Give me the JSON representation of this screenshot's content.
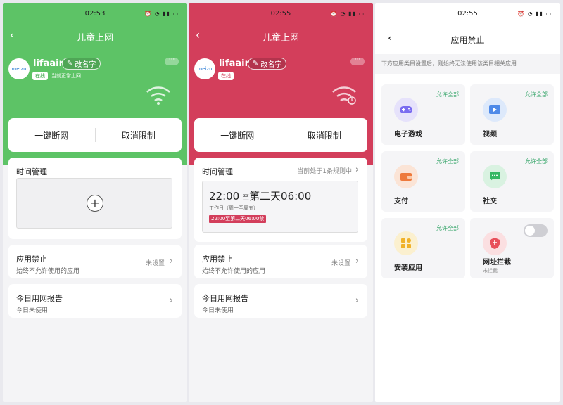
{
  "panel1": {
    "time": "02:53",
    "title": "儿童上网",
    "logo": "meizu",
    "device_name": "lifaair",
    "rename": "改名字",
    "online": "在线",
    "online_status": "当前正常上网",
    "actions": [
      "一键断网",
      "取消限制"
    ],
    "time_mgmt_title": "时间管理",
    "app_block_title": "应用禁止",
    "app_block_desc": "始终不允许使用的应用",
    "app_block_value": "未设置",
    "report_title": "今日用网报告",
    "report_desc": "今日未使用",
    "accent": "#5dc366"
  },
  "panel2": {
    "time": "02:55",
    "title": "儿童上网",
    "logo": "meizu",
    "device_name": "lifaair",
    "rename": "改名字",
    "online": "在线",
    "actions": [
      "一键断网",
      "取消限制"
    ],
    "time_mgmt_title": "时间管理",
    "time_mgmt_hint": "当前处于1条规则中",
    "rule_start": "22:00",
    "rule_to": "至",
    "rule_end": "第二天06:00",
    "rule_days": "工作日（周一至周五）",
    "rule_tag": "22:00至第二天06:00禁",
    "app_block_title": "应用禁止",
    "app_block_desc": "始终不允许使用的应用",
    "app_block_value": "未设置",
    "report_title": "今日用网报告",
    "report_desc": "今日未使用",
    "accent": "#d33e5b"
  },
  "panel3": {
    "time": "02:55",
    "title": "应用禁止",
    "notice": "下方应用类目设置后，则始终无法使用该类目相关应用",
    "categories": [
      {
        "label": "电子游戏",
        "allow": "允许全部",
        "icon": "gamepad-icon"
      },
      {
        "label": "视频",
        "allow": "允许全部",
        "icon": "video-icon"
      },
      {
        "label": "支付",
        "allow": "允许全部",
        "icon": "wallet-icon"
      },
      {
        "label": "社交",
        "allow": "允许全部",
        "icon": "chat-icon"
      },
      {
        "label": "安装应用",
        "allow": "允许全部",
        "icon": "apps-icon"
      },
      {
        "label": "网址拦截",
        "sub": "未拦截",
        "icon": "shield-icon"
      }
    ]
  }
}
